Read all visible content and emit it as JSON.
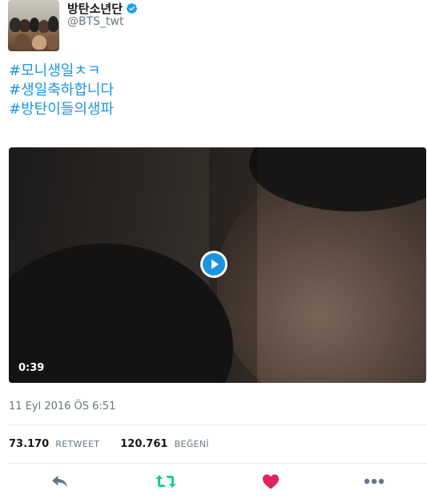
{
  "user": {
    "display_name": "방탄소년단",
    "handle": "@BTS_twt",
    "verified": true
  },
  "tweet": {
    "hashtags": [
      "#모니생일ㅊㅋ",
      "#생일축하합니다",
      "#방탄이들의생파"
    ],
    "timestamp": "11 Eyl 2016 ÖS 6:51"
  },
  "video": {
    "duration": "0:39"
  },
  "stats": {
    "retweet_count": "73.170",
    "retweet_label": "RETWEET",
    "like_count": "120.761",
    "like_label": "BEĞENİ"
  },
  "actions": {
    "icons": [
      "reply-icon",
      "retweet-icon",
      "like-icon",
      "more-icon"
    ],
    "retweet_color": "#19cf86",
    "like_color": "#e0245e",
    "icon_color": "#657786"
  },
  "colors": {
    "link": "#1b95e0",
    "muted": "#657786",
    "verified": "#1da1f2"
  }
}
